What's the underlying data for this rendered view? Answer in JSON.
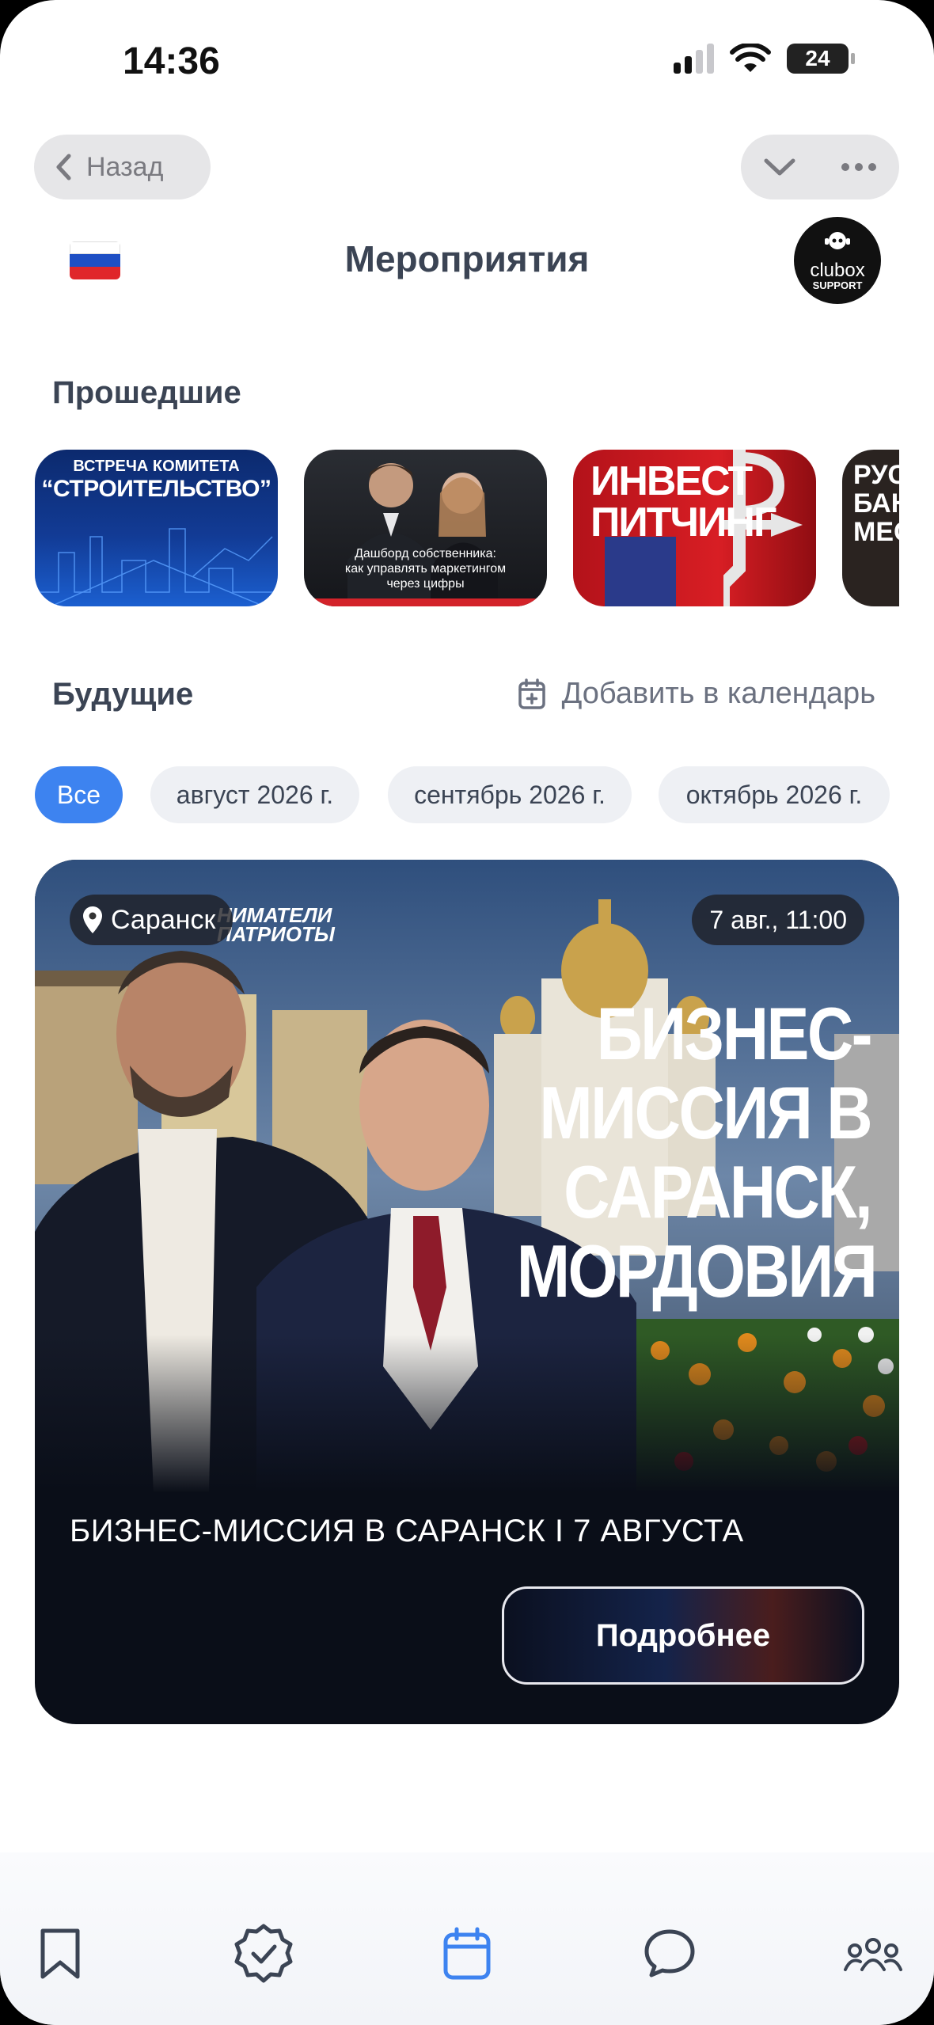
{
  "status_bar": {
    "time": "14:36",
    "battery": "24"
  },
  "nav": {
    "back_label": "Назад",
    "title": "Мероприятия",
    "logo_word": "clubox",
    "logo_sub": "SUPPORT"
  },
  "past": {
    "title": "Прошедшие",
    "cards": [
      {
        "lines": [
          "ВСТРЕЧА КОМИТЕТА",
          "“СТРОИТЕЛЬСТВО”"
        ]
      },
      {
        "lines": [
          "Дашборд собственника:",
          "как управлять маркетингом",
          "через цифры"
        ]
      },
      {
        "lines": [
          "ИНВЕСТ",
          "ПИТЧИНГ"
        ]
      },
      {
        "lines": [
          "РУС",
          "БАН",
          "МЕСТ"
        ]
      }
    ]
  },
  "future": {
    "title": "Будущие",
    "add_calendar": "Добавить в календарь",
    "filters": [
      "Все",
      "август 2026 г.",
      "сентябрь 2026 г.",
      "октябрь 2026 г."
    ]
  },
  "event": {
    "location": "Саранск",
    "datetime": "7 авг., 11:00",
    "org_text": "НИМАТЕЛИ",
    "org_text2": "ПАТРИОТЫ",
    "headline_lines": [
      "БИЗНЕС-",
      "МИССИЯ В",
      "САРАНСК,",
      "МОРДОВИЯ"
    ],
    "title": "БИЗНЕС-МИССИЯ В САРАНСК I 7 АВГУСТА",
    "button": "Подробнее"
  },
  "colors": {
    "accent": "#3d83f0",
    "text_dark": "#3b4454",
    "chip_bg": "#eef0f4"
  },
  "tabs": [
    "bookmark-icon",
    "verified-badge-icon",
    "calendar-icon",
    "chat-icon",
    "people-icon"
  ]
}
